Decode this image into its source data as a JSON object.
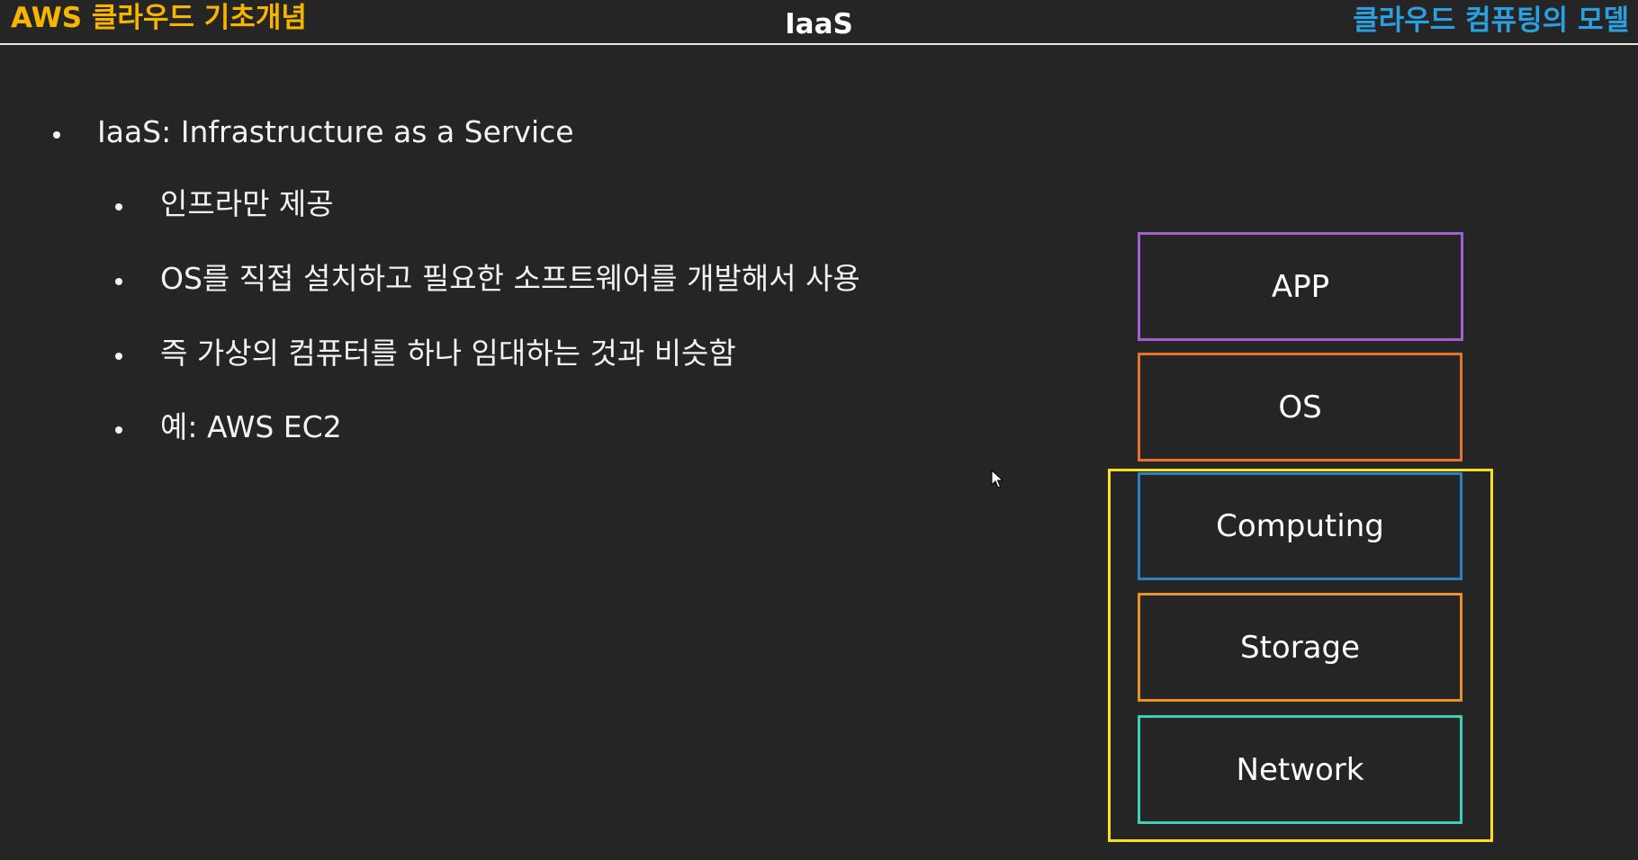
{
  "header": {
    "left_title": "AWS 클라우드 기초개념",
    "center_title": "IaaS",
    "right_title": "클라우드 컴퓨팅의 모델"
  },
  "bullets": {
    "main": "IaaS: Infrastructure as a Service",
    "sub": [
      "인프라만 제공",
      "OS를 직접 설치하고 필요한 소프트웨어를 개발해서 사용",
      "즉 가상의 컴퓨터를 하나 임대하는 것과 비슷함",
      "예: AWS EC2"
    ]
  },
  "stack": {
    "layers": [
      {
        "label": "APP",
        "color": "#a35fd0"
      },
      {
        "label": "OS",
        "color": "#e4742c"
      },
      {
        "label": "Computing",
        "color": "#2d7fc0"
      },
      {
        "label": "Storage",
        "color": "#e8902c"
      },
      {
        "label": "Network",
        "color": "#3ccfb4"
      }
    ],
    "iaas_group_color": "#f5e11e"
  },
  "colors": {
    "background": "#252525",
    "left_title": "#f7b500",
    "right_title": "#2ba0e0"
  },
  "icons": [
    "mouse-cursor-icon"
  ]
}
